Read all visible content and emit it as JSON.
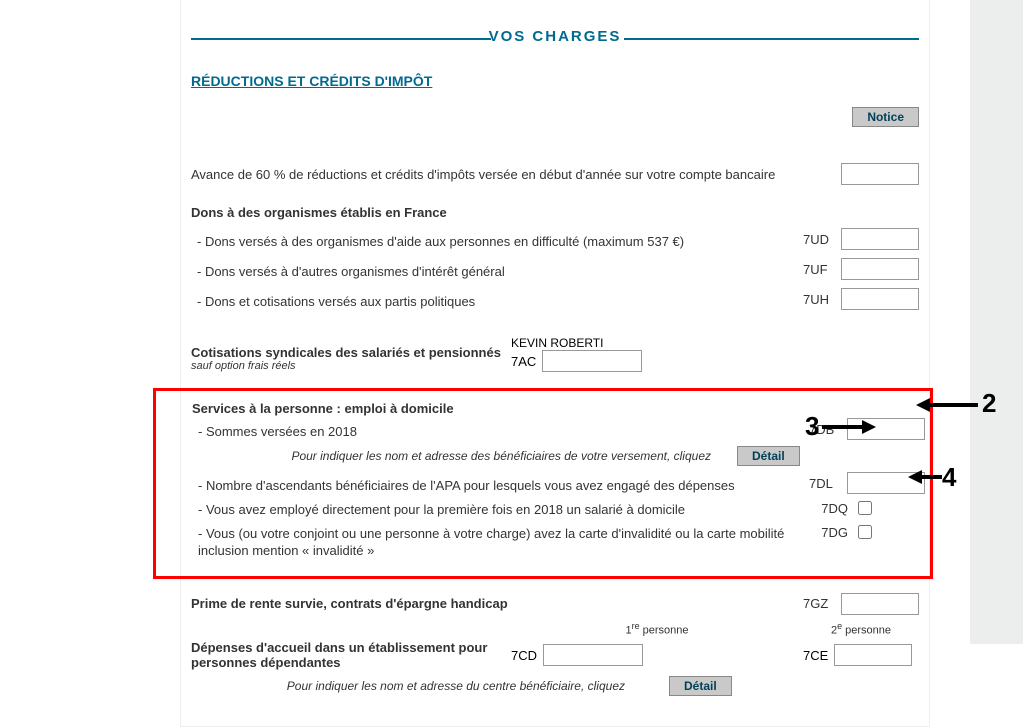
{
  "header": {
    "title": "VOS CHARGES",
    "subtitle": "RÉDUCTIONS ET CRÉDITS D'IMPÔT",
    "notice_label": "Notice"
  },
  "avance": {
    "text": "Avance de 60 % de réductions et crédits d'impôts versée en début d'année sur votre compte bancaire"
  },
  "dons": {
    "heading": "Dons à des organismes établis en France",
    "lines": [
      {
        "label": "- Dons versés à des organismes d'aide aux personnes en difficulté (maximum 537 €)",
        "code": "7UD"
      },
      {
        "label": "- Dons versés à d'autres organismes d'intérêt général",
        "code": "7UF"
      },
      {
        "label": "- Dons et cotisations versés aux partis politiques",
        "code": "7UH"
      }
    ]
  },
  "cotisations": {
    "heading": "Cotisations syndicales des salariés et pensionnés",
    "subnote": "sauf option frais réels",
    "person": "KEVIN ROBERTI",
    "code": "7AC"
  },
  "services": {
    "heading": "Services à la personne : emploi à domicile",
    "line_sommes": "- Sommes versées en 2018",
    "code_sommes": "7DB",
    "help_line": "Pour indiquer les nom et adresse des bénéficiaires de votre versement, cliquez",
    "detail_label": "Détail",
    "line_ascendants": "- Nombre d'ascendants bénéficiaires de l'APA pour lesquels vous avez engagé des dépenses",
    "code_ascendants": "7DL",
    "line_salarie": "- Vous avez employé directement pour la première fois en 2018 un salarié à domicile",
    "code_salarie": "7DQ",
    "line_invalidite": "- Vous (ou votre conjoint ou une personne à votre charge) avez la carte d'invalidité ou la carte mobilité inclusion mention « invalidité »",
    "code_invalidite": "7DG"
  },
  "prime": {
    "heading": "Prime de rente survie, contrats d'épargne handicap",
    "code": "7GZ"
  },
  "depenses": {
    "heading": "Dépenses d'accueil dans un établissement pour personnes dépendantes",
    "col1_header": "1re personne",
    "col2_header": "2e personne",
    "code1": "7CD",
    "code2": "7CE",
    "help_line": "Pour indiquer les nom et adresse du centre bénéficiaire, cliquez",
    "detail_label": "Détail"
  },
  "annotations": {
    "a2": "2",
    "a3": "3",
    "a4": "4"
  }
}
